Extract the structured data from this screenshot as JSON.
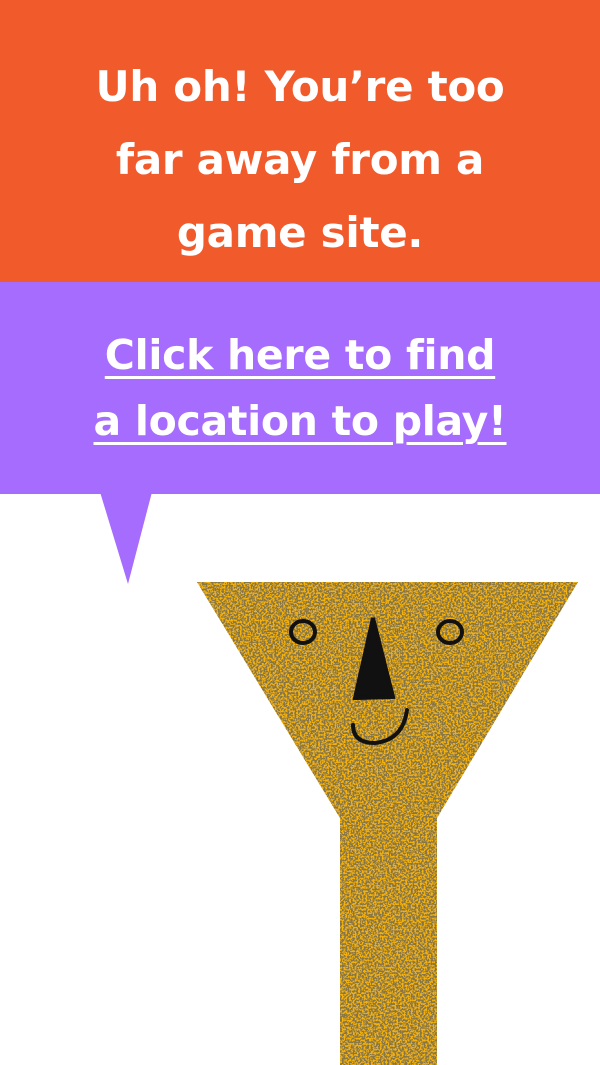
{
  "warning": {
    "lines": [
      "Uh oh! You’re too",
      "far away from a",
      "game site."
    ]
  },
  "cta": {
    "lines": [
      "Click here to find",
      "a location to play!"
    ]
  },
  "mascot": {
    "icon": "funnel-character-icon"
  },
  "colors": {
    "banner": "#f15a2b",
    "bubble": "#a66cfd",
    "mascot": "#f5b20f",
    "mascot_texture": "#3d2d10",
    "text": "#ffffff",
    "background": "#ffffff"
  }
}
